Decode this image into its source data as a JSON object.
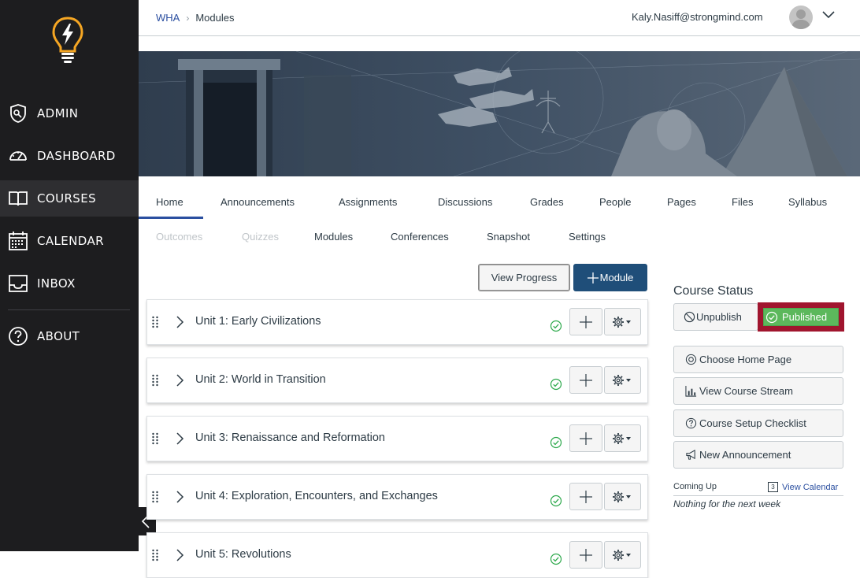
{
  "sidebar": {
    "items": [
      {
        "label": "ADMIN",
        "icon": "shield-icon"
      },
      {
        "label": "DASHBOARD",
        "icon": "dashboard-icon"
      },
      {
        "label": "COURSES",
        "icon": "book-icon"
      },
      {
        "label": "CALENDAR",
        "icon": "calendar-icon"
      },
      {
        "label": "INBOX",
        "icon": "inbox-icon"
      },
      {
        "label": "ABOUT",
        "icon": "help-icon"
      }
    ],
    "active": "COURSES",
    "bg_color": "#1d1d1f",
    "accent_color": "#f5a623"
  },
  "header": {
    "breadcrumb": {
      "course": "WHA",
      "current": "Modules"
    },
    "user_email": "Kaly.Nasiff@strongmind.com"
  },
  "tabs": {
    "row1": [
      "Home",
      "Announcements",
      "Assignments",
      "Discussions",
      "Grades",
      "People",
      "Pages",
      "Files",
      "Syllabus"
    ],
    "row2": [
      "Outcomes",
      "Quizzes",
      "Modules",
      "Conferences",
      "Snapshot",
      "Settings"
    ],
    "active": "Home",
    "disabled": [
      "Outcomes",
      "Quizzes"
    ]
  },
  "toolbar": {
    "view_progress_label": "View Progress",
    "add_module_label": "Module"
  },
  "modules": [
    {
      "title": "Unit 1: Early Civilizations",
      "published": true
    },
    {
      "title": "Unit 2: World in Transition",
      "published": true
    },
    {
      "title": "Unit 3: Renaissance and Reformation",
      "published": true
    },
    {
      "title": "Unit 4: Exploration, Encounters, and Exchanges",
      "published": true
    },
    {
      "title": "Unit 5: Revolutions",
      "published": true
    }
  ],
  "course_status": {
    "title": "Course Status",
    "unpublish_label": "Unpublish",
    "published_label": "Published",
    "published_color": "#5cb85c",
    "highlight_color": "#a0152e"
  },
  "side_actions": [
    {
      "label": "Choose Home Page",
      "icon": "target-icon"
    },
    {
      "label": "View Course Stream",
      "icon": "stream-chart-icon"
    },
    {
      "label": "Course Setup Checklist",
      "icon": "question-circle-icon"
    },
    {
      "label": "New Announcement",
      "icon": "megaphone-icon"
    }
  ],
  "coming_up": {
    "label": "Coming Up",
    "view_calendar_label": "View Calendar",
    "calendar_day": "3",
    "empty_text": "Nothing for the next week"
  }
}
